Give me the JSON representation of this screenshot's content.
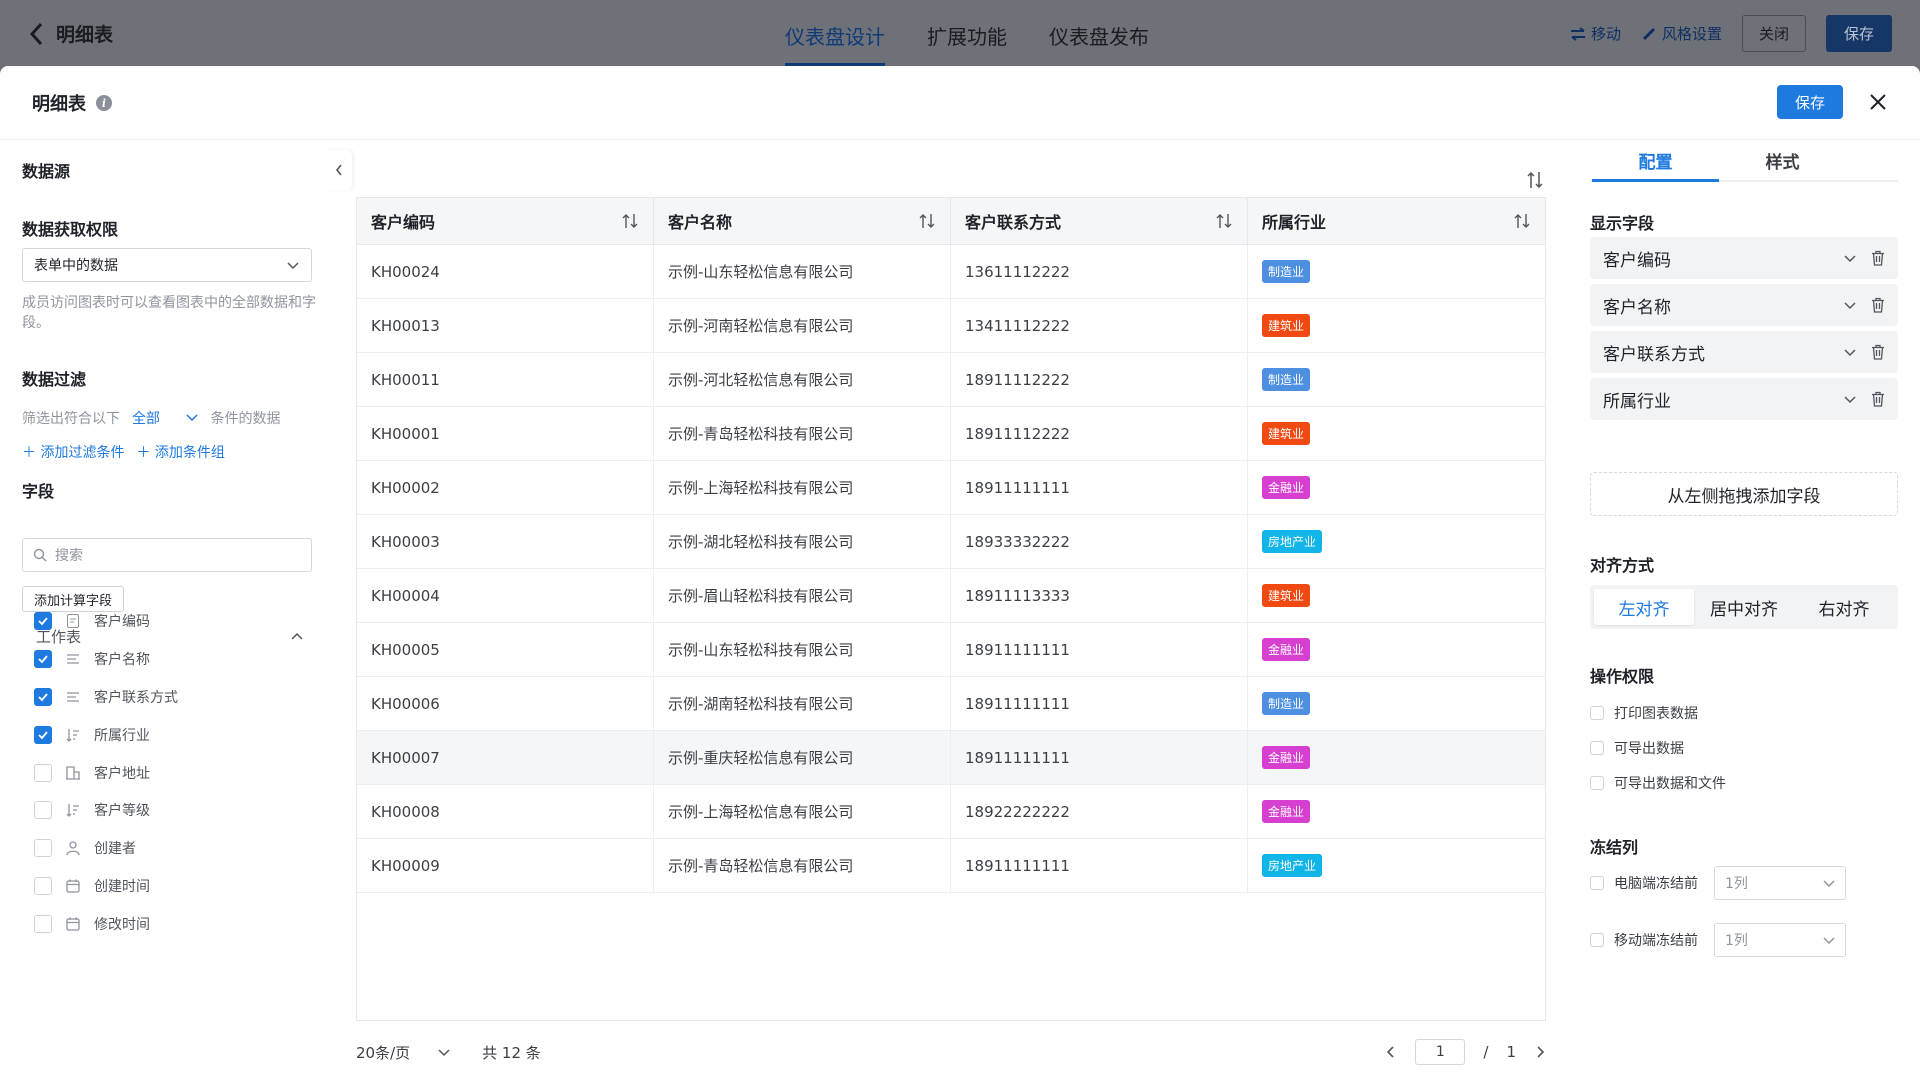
{
  "topbar": {
    "back_label": "明细表",
    "tabs": [
      {
        "label": "仪表盘设计",
        "active": true
      },
      {
        "label": "扩展功能",
        "active": false
      },
      {
        "label": "仪表盘发布",
        "active": false
      }
    ],
    "move_label": "移动",
    "style_label": "风格设置",
    "close_label": "关闭",
    "save_label": "保存"
  },
  "modal": {
    "title": "明细表",
    "info_icon": "i",
    "save_label": "保存"
  },
  "left": {
    "datasource_title": "数据源",
    "permission_title": "数据获取权限",
    "permission_value": "表单中的数据",
    "permission_hint": "成员访问图表时可以查看图表中的全部数据和字段。",
    "filter_title": "数据过滤",
    "filter_prefix": "筛选出符合以下",
    "filter_mode": "全部",
    "filter_suffix": "条件的数据",
    "add_filter": "添加过滤条件",
    "add_group": "添加条件组",
    "fields_title": "字段",
    "search_placeholder": "搜索",
    "calc_field": "添加计算字段",
    "group_label": "工作表",
    "fields": [
      {
        "label": "客户编码",
        "checked": true,
        "icon": "text-field-icon"
      },
      {
        "label": "客户名称",
        "checked": true,
        "icon": "lines-icon"
      },
      {
        "label": "客户联系方式",
        "checked": true,
        "icon": "lines-icon"
      },
      {
        "label": "所属行业",
        "checked": true,
        "icon": "sort-list-icon"
      },
      {
        "label": "客户地址",
        "checked": false,
        "icon": "building-icon"
      },
      {
        "label": "客户等级",
        "checked": false,
        "icon": "sort-list-icon"
      },
      {
        "label": "创建者",
        "checked": false,
        "icon": "user-icon"
      },
      {
        "label": "创建时间",
        "checked": false,
        "icon": "calendar-icon"
      },
      {
        "label": "修改时间",
        "checked": false,
        "icon": "calendar-icon"
      }
    ]
  },
  "table": {
    "columns": [
      "客户编码",
      "客户名称",
      "客户联系方式",
      "所属行业"
    ],
    "rows": [
      {
        "code": "KH00024",
        "name": "示例-山东轻松信息有限公司",
        "phone": "13611112222",
        "industry": "制造业"
      },
      {
        "code": "KH00013",
        "name": "示例-河南轻松信息有限公司",
        "phone": "13411112222",
        "industry": "建筑业"
      },
      {
        "code": "KH00011",
        "name": "示例-河北轻松信息有限公司",
        "phone": "18911112222",
        "industry": "制造业"
      },
      {
        "code": "KH00001",
        "name": "示例-青岛轻松科技有限公司",
        "phone": "18911112222",
        "industry": "建筑业"
      },
      {
        "code": "KH00002",
        "name": "示例-上海轻松科技有限公司",
        "phone": "18911111111",
        "industry": "金融业"
      },
      {
        "code": "KH00003",
        "name": "示例-湖北轻松科技有限公司",
        "phone": "18933332222",
        "industry": "房地产业"
      },
      {
        "code": "KH00004",
        "name": "示例-眉山轻松科技有限公司",
        "phone": "18911113333",
        "industry": "建筑业"
      },
      {
        "code": "KH00005",
        "name": "示例-山东轻松科技有限公司",
        "phone": "18911111111",
        "industry": "金融业"
      },
      {
        "code": "KH00006",
        "name": "示例-湖南轻松科技有限公司",
        "phone": "18911111111",
        "industry": "制造业"
      },
      {
        "code": "KH00007",
        "name": "示例-重庆轻松信息有限公司",
        "phone": "18911111111",
        "industry": "金融业"
      },
      {
        "code": "KH00008",
        "name": "示例-上海轻松信息有限公司",
        "phone": "18922222222",
        "industry": "金融业"
      },
      {
        "code": "KH00009",
        "name": "示例-青岛轻松信息有限公司",
        "phone": "18911111111",
        "industry": "房地产业"
      }
    ],
    "tag_colors": {
      "制造业": "#4d8fe0",
      "建筑业": "#f04a12",
      "金融业": "#d63fd0",
      "房地产业": "#12b5e8"
    },
    "page_size": "20条/页",
    "total": "共 12 条",
    "current_page": "1",
    "separator": "/",
    "total_pages": "1"
  },
  "right": {
    "tabs": [
      {
        "label": "配置",
        "active": true
      },
      {
        "label": "样式",
        "active": false
      }
    ],
    "display_fields_title": "显示字段",
    "display_fields": [
      "客户编码",
      "客户名称",
      "客户联系方式",
      "所属行业"
    ],
    "dropzone": "从左侧拖拽添加字段",
    "align_title": "对齐方式",
    "align_options": [
      "左对齐",
      "居中对齐",
      "右对齐"
    ],
    "align_active": "左对齐",
    "perm_title": "操作权限",
    "perms": [
      "打印图表数据",
      "可导出数据",
      "可导出数据和文件"
    ],
    "freeze_title": "冻结列",
    "freeze": [
      {
        "label": "电脑端冻结前",
        "value": "1列"
      },
      {
        "label": "移动端冻结前",
        "value": "1列"
      }
    ]
  },
  "colors": {
    "accent": "#1f7ae0"
  }
}
